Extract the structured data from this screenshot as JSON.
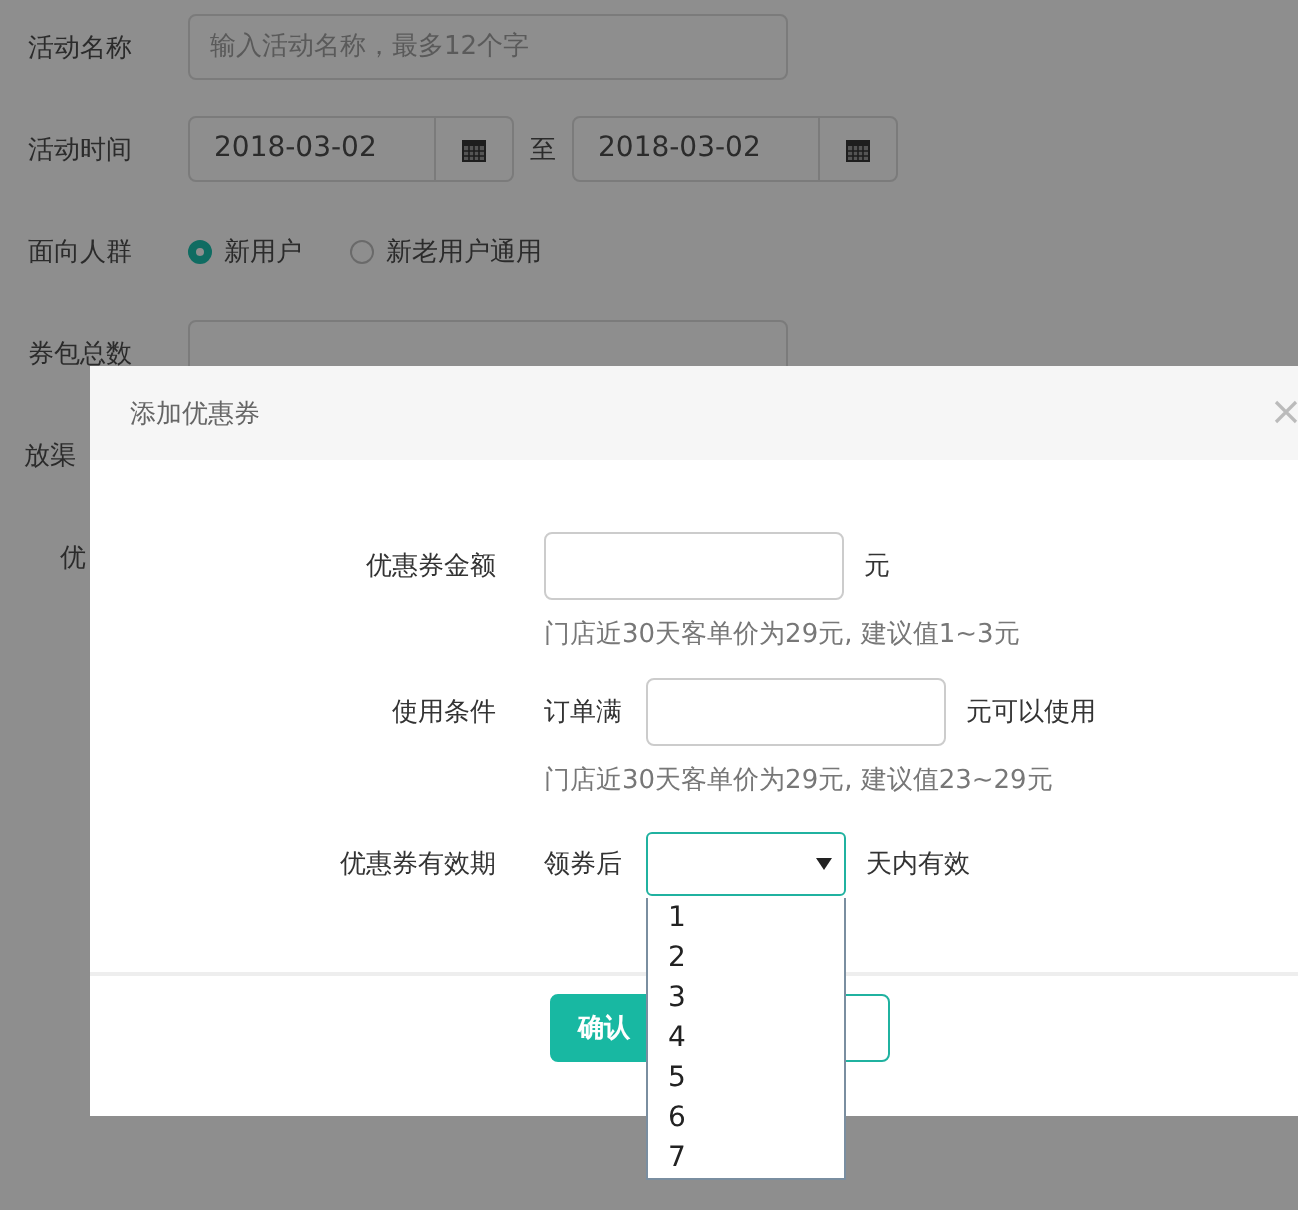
{
  "background_form": {
    "rows": [
      {
        "kind": "text",
        "label": "活动名称",
        "placeholder": "输入活动名称，最多12个字"
      },
      {
        "kind": "daterange",
        "label": "活动时间",
        "start": "2018-03-02",
        "separator": "至",
        "end": "2018-03-02"
      },
      {
        "kind": "radio",
        "label": "面向人群",
        "options": [
          {
            "label": "新用户",
            "selected": true
          },
          {
            "label": "新老用户通用",
            "selected": false
          }
        ]
      },
      {
        "kind": "text",
        "label": "券包总数"
      },
      {
        "kind": "cut",
        "label": "放渠"
      },
      {
        "kind": "cut",
        "label": "优"
      }
    ]
  },
  "dialog": {
    "title": "添加优惠券",
    "amount": {
      "label": "优惠券金额",
      "unit": "元",
      "hint": "门店近30天客单价为29元, 建议值1~3元"
    },
    "condition": {
      "label": "使用条件",
      "prefix": "订单满",
      "suffix": "元可以使用",
      "hint": "门店近30天客单价为29元, 建议值23~29元"
    },
    "validity": {
      "label": "优惠券有效期",
      "prefix": "领券后",
      "suffix": "天内有效",
      "expanded": true,
      "options": [
        "1",
        "2",
        "3",
        "4",
        "5",
        "6",
        "7"
      ]
    },
    "buttons": [
      {
        "kind": "primary",
        "label": "确认"
      },
      {
        "kind": "secondary"
      }
    ]
  }
}
